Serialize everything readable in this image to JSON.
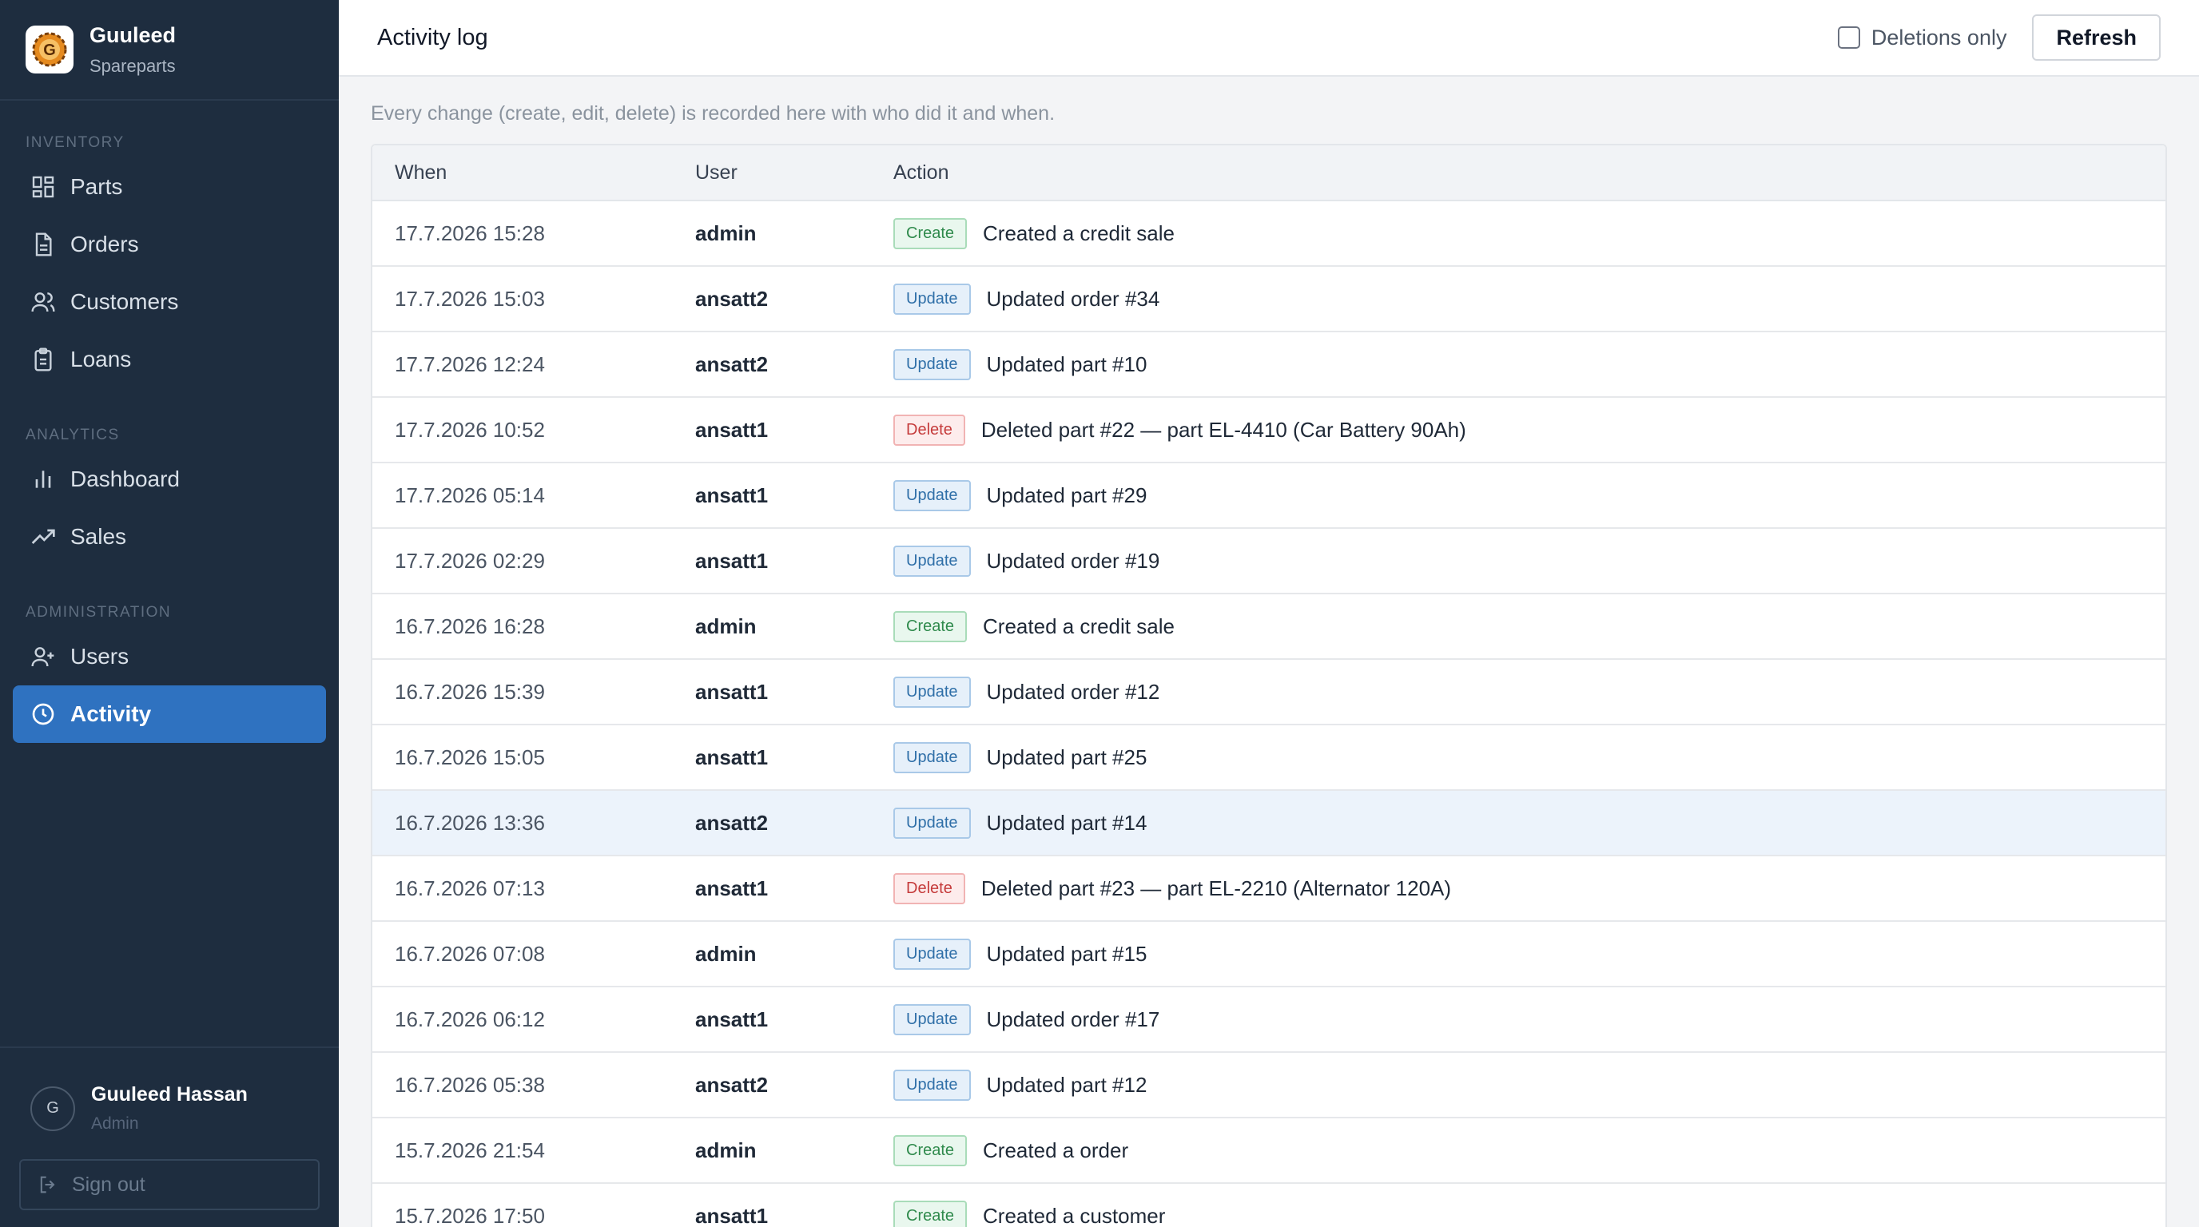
{
  "brand": {
    "name": "Guuleed",
    "subtitle": "Spareparts"
  },
  "sidebar": {
    "sections": [
      {
        "label": "INVENTORY",
        "items": [
          {
            "label": "Parts",
            "icon": "grid-icon"
          },
          {
            "label": "Orders",
            "icon": "document-icon"
          },
          {
            "label": "Customers",
            "icon": "users-icon"
          },
          {
            "label": "Loans",
            "icon": "clipboard-icon"
          }
        ]
      },
      {
        "label": "ANALYTICS",
        "items": [
          {
            "label": "Dashboard",
            "icon": "bar-chart-icon"
          },
          {
            "label": "Sales",
            "icon": "trending-up-icon"
          }
        ]
      },
      {
        "label": "ADMINISTRATION",
        "items": [
          {
            "label": "Users",
            "icon": "user-plus-icon"
          },
          {
            "label": "Activity",
            "icon": "clock-icon",
            "active": true
          }
        ]
      }
    ]
  },
  "user": {
    "initial": "G",
    "name": "Guuleed Hassan",
    "role": "Admin"
  },
  "signout_label": "Sign out",
  "header": {
    "title": "Activity log",
    "filter_label": "Deletions only",
    "filter_checked": false,
    "refresh_label": "Refresh"
  },
  "description": "Every change (create, edit, delete) is recorded here with who did it and when.",
  "table": {
    "columns": [
      "When",
      "User",
      "Action"
    ],
    "rows": [
      {
        "when": "17.7.2026 15:28",
        "user": "admin",
        "type": "Create",
        "action": "Created a credit sale"
      },
      {
        "when": "17.7.2026 15:03",
        "user": "ansatt2",
        "type": "Update",
        "action": "Updated order #34"
      },
      {
        "when": "17.7.2026 12:24",
        "user": "ansatt2",
        "type": "Update",
        "action": "Updated part #10"
      },
      {
        "when": "17.7.2026 10:52",
        "user": "ansatt1",
        "type": "Delete",
        "action": "Deleted part #22 — part EL-4410 (Car Battery 90Ah)"
      },
      {
        "when": "17.7.2026 05:14",
        "user": "ansatt1",
        "type": "Update",
        "action": "Updated part #29"
      },
      {
        "when": "17.7.2026 02:29",
        "user": "ansatt1",
        "type": "Update",
        "action": "Updated order #19"
      },
      {
        "when": "16.7.2026 16:28",
        "user": "admin",
        "type": "Create",
        "action": "Created a credit sale"
      },
      {
        "when": "16.7.2026 15:39",
        "user": "ansatt1",
        "type": "Update",
        "action": "Updated order #12"
      },
      {
        "when": "16.7.2026 15:05",
        "user": "ansatt1",
        "type": "Update",
        "action": "Updated part #25"
      },
      {
        "when": "16.7.2026 13:36",
        "user": "ansatt2",
        "type": "Update",
        "action": "Updated part #14",
        "highlight": true
      },
      {
        "when": "16.7.2026 07:13",
        "user": "ansatt1",
        "type": "Delete",
        "action": "Deleted part #23 — part EL-2210 (Alternator 120A)"
      },
      {
        "when": "16.7.2026 07:08",
        "user": "admin",
        "type": "Update",
        "action": "Updated part #15"
      },
      {
        "when": "16.7.2026 06:12",
        "user": "ansatt1",
        "type": "Update",
        "action": "Updated order #17"
      },
      {
        "when": "16.7.2026 05:38",
        "user": "ansatt2",
        "type": "Update",
        "action": "Updated part #12"
      },
      {
        "when": "15.7.2026 21:54",
        "user": "admin",
        "type": "Create",
        "action": "Created a order"
      },
      {
        "when": "15.7.2026 17:50",
        "user": "ansatt1",
        "type": "Create",
        "action": "Created a customer"
      }
    ]
  }
}
